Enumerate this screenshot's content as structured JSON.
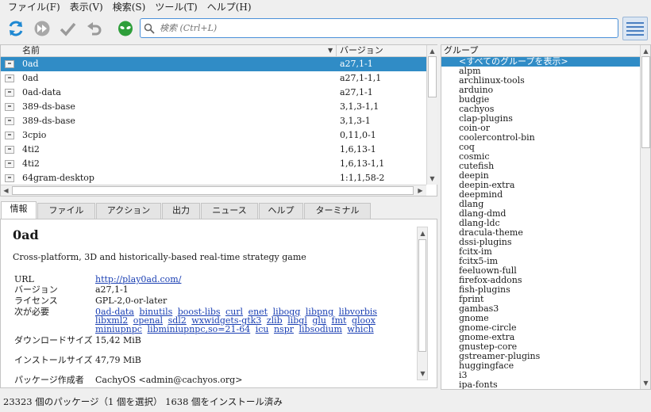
{
  "menu": [
    {
      "label": "ファイル(F)"
    },
    {
      "label": "表示(V)"
    },
    {
      "label": "検索(S)"
    },
    {
      "label": "ツール(T)"
    },
    {
      "label": "ヘルプ(H)"
    }
  ],
  "toolbar": {
    "buttons": [
      {
        "name": "refresh-icon",
        "color": "#1e88d2"
      },
      {
        "name": "fast-forward-icon",
        "color": "#9a9a9a"
      },
      {
        "name": "checkmark-icon",
        "color": "#9a9a9a"
      },
      {
        "name": "undo-icon",
        "color": "#9a9a9a"
      },
      {
        "name": "alien-icon",
        "color": "#2e9e3a"
      }
    ],
    "search_placeholder": "検索 (Ctrl+L)"
  },
  "packages": {
    "columns": {
      "name": "名前",
      "version": "バージョン"
    },
    "rows": [
      {
        "name": "0ad",
        "version": "a27,1-1",
        "selected": true
      },
      {
        "name": "0ad",
        "version": "a27,1-1,1"
      },
      {
        "name": "0ad-data",
        "version": "a27,1-1"
      },
      {
        "name": "389-ds-base",
        "version": "3,1,3-1,1"
      },
      {
        "name": "389-ds-base",
        "version": "3,1,3-1"
      },
      {
        "name": "3cpio",
        "version": "0,11,0-1"
      },
      {
        "name": "4ti2",
        "version": "1,6,13-1"
      },
      {
        "name": "4ti2",
        "version": "1,6,13-1,1"
      },
      {
        "name": "64gram-desktop",
        "version": "1:1,1,58-2"
      }
    ]
  },
  "tabs": [
    {
      "label": "情報",
      "active": true
    },
    {
      "label": "ファイル"
    },
    {
      "label": "アクション"
    },
    {
      "label": "出力"
    },
    {
      "label": "ニュース"
    },
    {
      "label": "ヘルプ"
    },
    {
      "label": "ターミナル"
    }
  ],
  "info": {
    "title": "0ad",
    "description": "Cross-platform, 3D and historically-based real-time strategy game",
    "url_label": "URL",
    "url": "http://play0ad.com/",
    "version_label": "バージョン",
    "version": "a27,1-1",
    "license_label": "ライセンス",
    "license": "GPL-2,0-or-later",
    "depends_label": "次が必要",
    "depends": [
      "0ad-data",
      "binutils",
      "boost-libs",
      "curl",
      "enet",
      "libogg",
      "libpng",
      "libvorbis",
      "libxml2",
      "openal",
      "sdl2",
      "wxwidgets-gtk3",
      "zlib",
      "libgl",
      "glu",
      "fmt",
      "gloox",
      "miniupnpc",
      "libminiupnpc,so=21-64",
      "icu",
      "nspr",
      "libsodium",
      "which"
    ],
    "download_label": "ダウンロードサイズ",
    "download_size": "15,42 MiB",
    "install_label": "インストールサイズ",
    "install_size": "47,79 MiB",
    "packager_label": "パッケージ作成者",
    "packager": "CachyOS <admin@cachyos.org>"
  },
  "groups": {
    "header": "グループ",
    "items": [
      "<すべてのグループを表示>",
      "alpm",
      "archlinux-tools",
      "arduino",
      "budgie",
      "cachyos",
      "clap-plugins",
      "coin-or",
      "coolercontrol-bin",
      "coq",
      "cosmic",
      "cutefish",
      "deepin",
      "deepin-extra",
      "deepmind",
      "dlang",
      "dlang-dmd",
      "dlang-ldc",
      "dracula-theme",
      "dssi-plugins",
      "fcitx-im",
      "fcitx5-im",
      "feeluown-full",
      "firefox-addons",
      "fish-plugins",
      "fprint",
      "gambas3",
      "gnome",
      "gnome-circle",
      "gnome-extra",
      "gnustep-core",
      "gstreamer-plugins",
      "huggingface",
      "i3",
      "ipa-fonts"
    ]
  },
  "status": "23323 個のパッケージ（1 個を選択） 1638 個をインストール済み"
}
